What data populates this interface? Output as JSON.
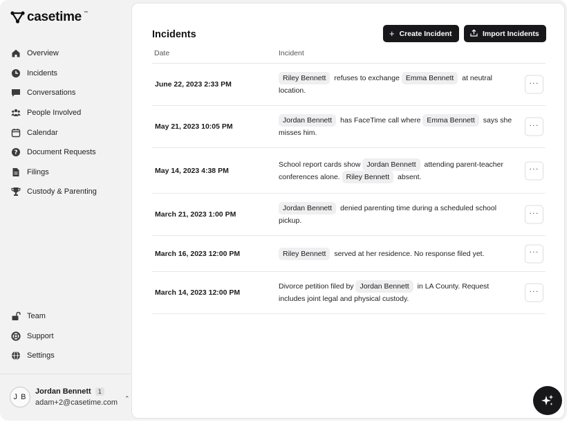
{
  "app": {
    "logo_text": "casetime",
    "logo_mark": "™"
  },
  "sidebar": {
    "items": [
      {
        "label": "Overview",
        "icon": "home-icon"
      },
      {
        "label": "Incidents",
        "icon": "clock-icon"
      },
      {
        "label": "Conversations",
        "icon": "chat-icon"
      },
      {
        "label": "People Involved",
        "icon": "people-icon"
      },
      {
        "label": "Calendar",
        "icon": "calendar-icon"
      },
      {
        "label": "Document Requests",
        "icon": "question-icon"
      },
      {
        "label": "Filings",
        "icon": "file-icon"
      },
      {
        "label": "Custody & Parenting",
        "icon": "trophy-icon"
      }
    ],
    "bottom_items": [
      {
        "label": "Team",
        "icon": "lock-open-icon"
      },
      {
        "label": "Support",
        "icon": "lifebuoy-icon"
      },
      {
        "label": "Settings",
        "icon": "globe-icon"
      }
    ],
    "user": {
      "initials": "J B",
      "name": "Jordan Bennett",
      "badge": "1",
      "email": "adam+2@casetime.com"
    }
  },
  "main": {
    "title": "Incidents",
    "create_label": "Create Incident",
    "import_label": "Import Incidents",
    "columns": {
      "date": "Date",
      "incident": "Incident"
    },
    "rows": [
      {
        "date": "June 22, 2023 2:33 PM",
        "parts": [
          {
            "chip": "Riley Bennett"
          },
          {
            "text": "refuses to exchange"
          },
          {
            "chip": "Emma Bennett"
          },
          {
            "text": "at neutral location."
          }
        ]
      },
      {
        "date": "May 21, 2023 10:05 PM",
        "parts": [
          {
            "chip": "Jordan Bennett"
          },
          {
            "text": "has FaceTime call where"
          },
          {
            "chip": "Emma Bennett"
          },
          {
            "text": "says she misses him."
          }
        ]
      },
      {
        "date": "May 14, 2023 4:38 PM",
        "parts": [
          {
            "text": "School report cards show"
          },
          {
            "chip": "Jordan Bennett"
          },
          {
            "text": "attending parent-teacher conferences alone."
          },
          {
            "chip": "Riley Bennett"
          },
          {
            "text": "absent."
          }
        ]
      },
      {
        "date": "March 21, 2023 1:00 PM",
        "parts": [
          {
            "chip": "Jordan Bennett"
          },
          {
            "text": "denied parenting time during a scheduled school pickup."
          }
        ]
      },
      {
        "date": "March 16, 2023 12:00 PM",
        "parts": [
          {
            "chip": "Riley Bennett"
          },
          {
            "text": "served at her residence. No response filed yet."
          }
        ]
      },
      {
        "date": "March 14, 2023 12:00 PM",
        "parts": [
          {
            "text": "Divorce petition filed by"
          },
          {
            "chip": "Jordan Bennett"
          },
          {
            "text": "in LA County. Request includes joint legal and physical custody."
          }
        ]
      }
    ],
    "row_menu_label": "···"
  },
  "colors": {
    "sidebar_bg": "#f2f2f3",
    "button_bg": "#18181b",
    "chip_bg": "#efeff1"
  }
}
